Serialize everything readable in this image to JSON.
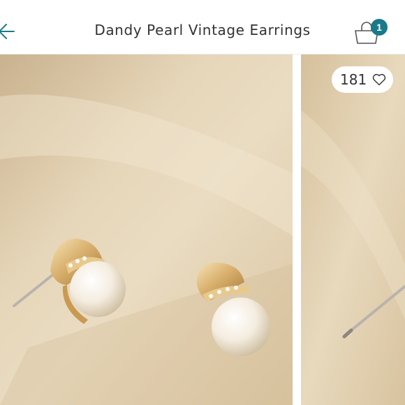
{
  "header": {
    "title": "Dandy Pearl Vintage Earrings",
    "back_icon": "arrow-left-icon",
    "cart_icon": "shopping-bag-icon",
    "cart_count": "1"
  },
  "gallery": {
    "likes_count": "181",
    "like_icon": "heart-outline-icon",
    "photos": [
      {
        "subject": "pearl earrings"
      },
      {
        "subject": "pearl earring"
      }
    ]
  },
  "colors": {
    "accent": "#1a7a8a",
    "background_photo": "#e3d2b4",
    "text": "#333333"
  }
}
